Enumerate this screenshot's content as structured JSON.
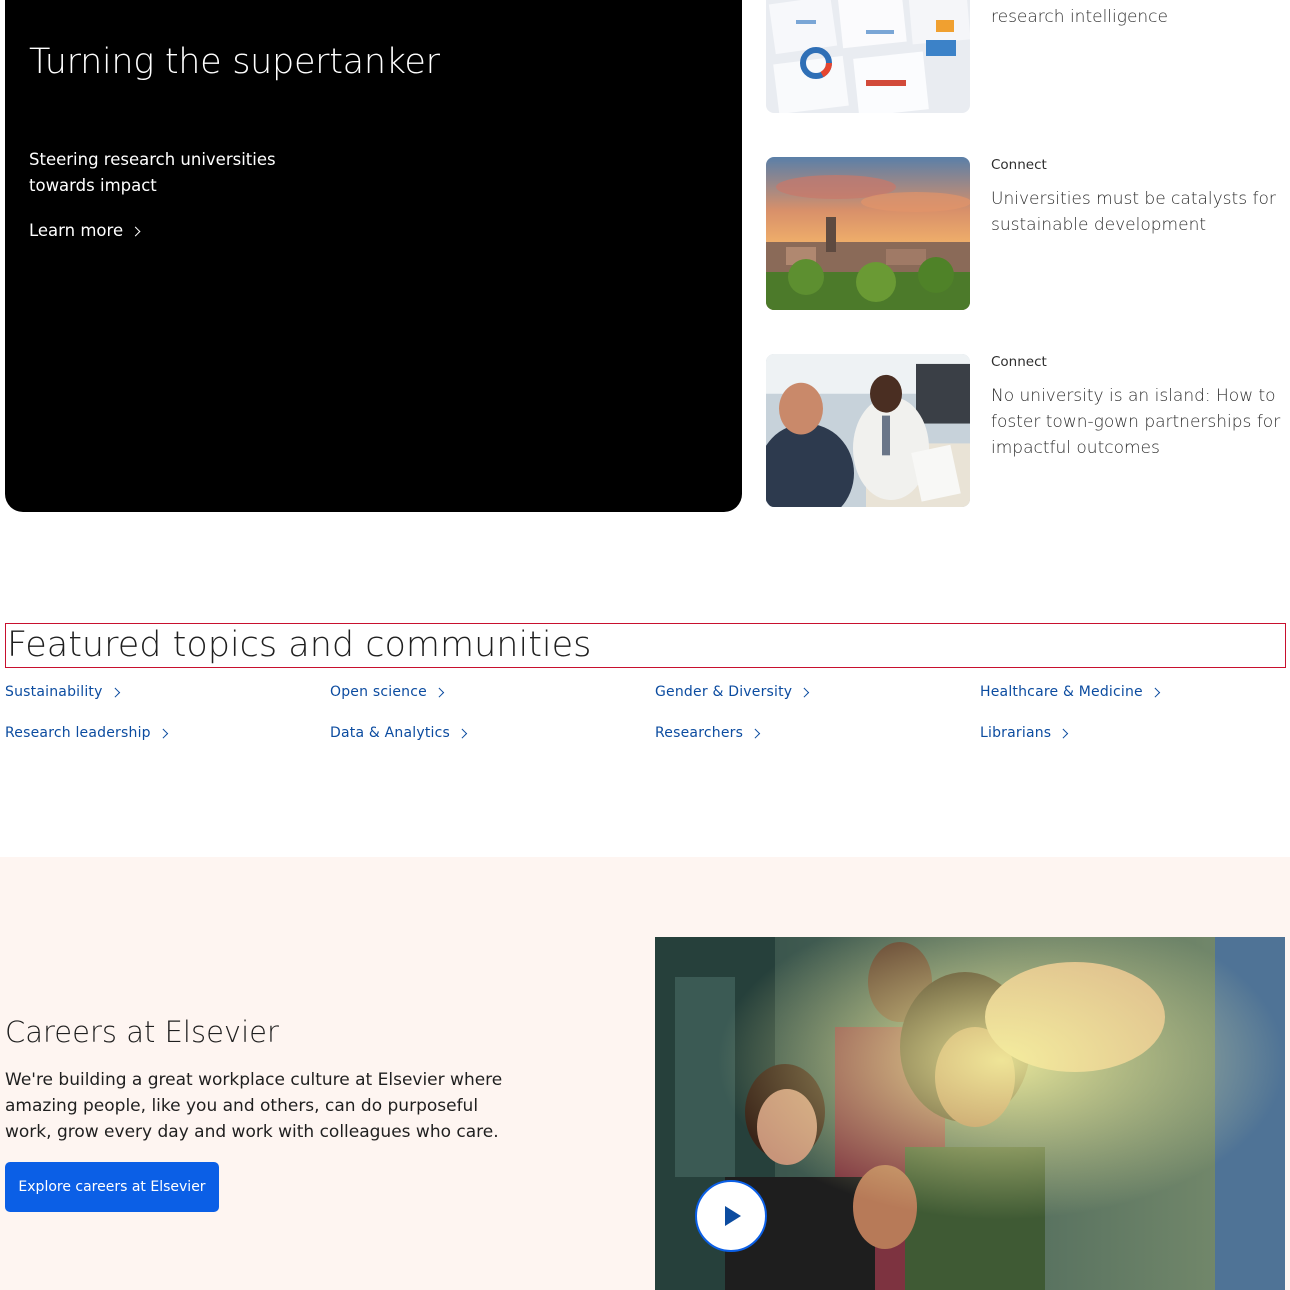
{
  "hero": {
    "title": "Turning the supertanker",
    "subtitle": "Steering research universities towards impact",
    "link_label": "Learn more"
  },
  "articles": [
    {
      "category": "",
      "title": "Putting the “competitive” into research intelligence",
      "image": "charts-papers-photo"
    },
    {
      "category": "Connect",
      "title": "Universities must be catalysts for sustainable development",
      "image": "campus-sunset-photo"
    },
    {
      "category": "Connect",
      "title": "No university is an island: How to foster town-gown partnerships for impactful outcomes",
      "image": "meeting-photo"
    }
  ],
  "featured": {
    "title": "Featured topics and communities",
    "topics": [
      "Sustainability",
      "Open science",
      "Gender & Diversity",
      "Healthcare & Medicine",
      "Research leadership",
      "Data & Analytics",
      "Researchers",
      "Librarians"
    ]
  },
  "careers": {
    "title": "Careers at Elsevier",
    "body": "We're building a great workplace culture at Elsevier where amazing people, like you and others, can do purposeful work, grow every day and work with colleagues who care.",
    "button_label": "Explore careers at Elsevier",
    "image": "team-celebrating-photo"
  },
  "colors": {
    "link": "#0c4ca0",
    "button": "#0b5fe6",
    "careers_bg": "#fef5f1",
    "highlight_border": "#c8102e"
  }
}
